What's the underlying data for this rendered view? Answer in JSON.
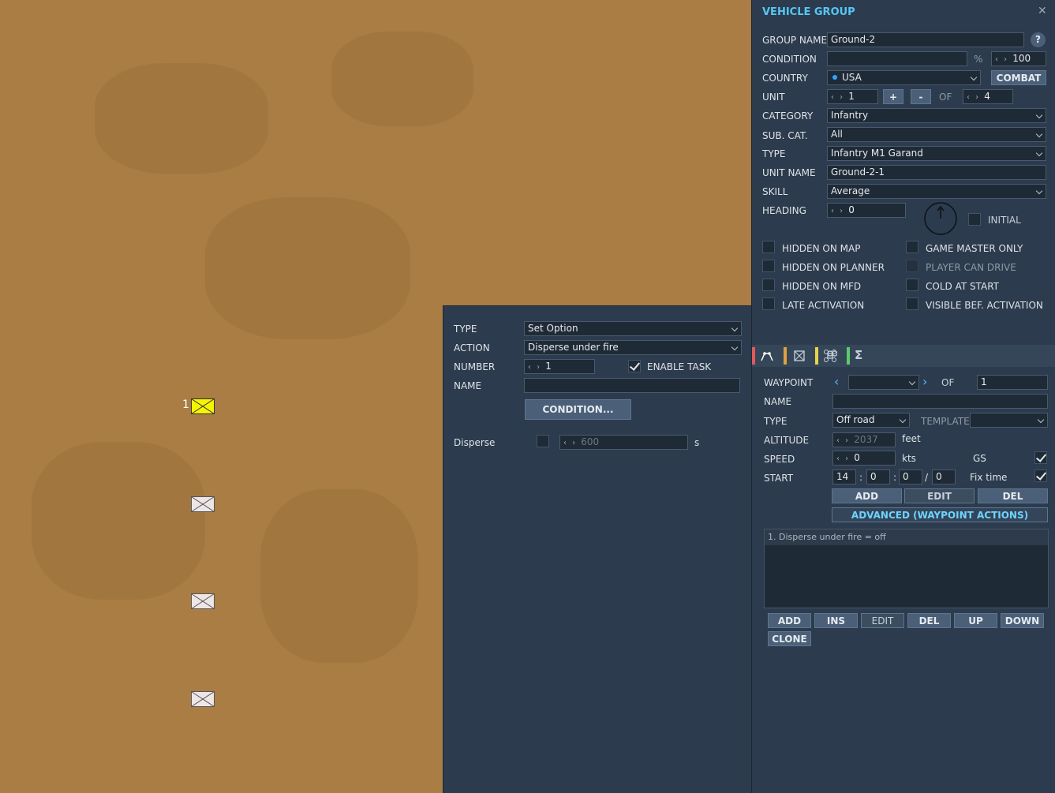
{
  "map": {
    "units": [
      {
        "label": "1",
        "active": true
      },
      {
        "label": "",
        "active": false
      },
      {
        "label": "",
        "active": false
      },
      {
        "label": "",
        "active": false
      }
    ],
    "colors": {
      "terrain": "#a97d44",
      "active_unit": "#f5f500",
      "inactive_unit": "#eee6e6"
    }
  },
  "task_panel": {
    "type_label": "TYPE",
    "type_value": "Set Option",
    "action_label": "ACTION",
    "action_value": "Disperse under fire",
    "number_label": "NUMBER",
    "number_value": "1",
    "enable_task_label": "ENABLE TASK",
    "enable_task_checked": true,
    "name_label": "NAME",
    "name_value": "",
    "condition_button": "CONDITION...",
    "disperse_label": "Disperse",
    "disperse_value": "600",
    "disperse_unit": "s"
  },
  "vehicle_group": {
    "title": "VEHICLE GROUP",
    "help": "?",
    "group_name_label": "GROUP NAME",
    "group_name_value": "Ground-2",
    "condition_label": "CONDITION",
    "condition_value": "",
    "condition_pct_symbol": "%",
    "condition_pct_value": "100",
    "country_label": "COUNTRY",
    "country_value": "USA",
    "combat_button": "COMBAT",
    "unit_label": "UNIT",
    "unit_value": "1",
    "plus_button": "+",
    "minus_button": "-",
    "of_label": "OF",
    "unit_total": "4",
    "category_label": "CATEGORY",
    "category_value": "Infantry",
    "subcat_label": "SUB. CAT.",
    "subcat_value": "All",
    "type_label": "TYPE",
    "type_value": "Infantry M1 Garand",
    "unit_name_label": "UNIT NAME",
    "unit_name_value": "Ground-2-1",
    "skill_label": "SKILL",
    "skill_value": "Average",
    "heading_label": "HEADING",
    "heading_value": "0",
    "initial_label": "INITIAL",
    "checkboxes": {
      "hidden_on_map": "HIDDEN ON MAP",
      "game_master_only": "GAME MASTER ONLY",
      "hidden_on_planner": "HIDDEN ON PLANNER",
      "player_can_drive": "PLAYER CAN DRIVE",
      "hidden_on_mfd": "HIDDEN ON MFD",
      "cold_at_start": "COLD AT START",
      "late_activation": "LATE ACTIVATION",
      "visible_bef_activation": "VISIBLE BEF. ACTIVATION"
    }
  },
  "waypoint": {
    "waypoint_label": "WAYPOINT",
    "waypoint_value": "",
    "of_label": "OF",
    "of_value": "1",
    "name_label": "NAME",
    "name_value": "",
    "type_label": "TYPE",
    "type_value": "Off road",
    "template_label": "TEMPLATE",
    "template_value": "",
    "altitude_label": "ALTITUDE",
    "altitude_value": "2037",
    "altitude_unit": "feet",
    "speed_label": "SPEED",
    "speed_value": "0",
    "speed_unit": "kts",
    "gs_label": "GS",
    "start_label": "START",
    "start_h": "14",
    "start_m": "0",
    "start_s": "0",
    "start_ms": "0",
    "sep_colon": ":",
    "sep_slash": "/",
    "fix_time_label": "Fix time",
    "add_button": "ADD",
    "edit_button": "EDIT",
    "del_button": "DEL",
    "advanced_button": "ADVANCED (WAYPOINT ACTIONS)",
    "actions": [
      "1. Disperse under fire = off"
    ],
    "list_buttons": {
      "add": "ADD",
      "ins": "INS",
      "edit": "EDIT",
      "del": "DEL",
      "up": "UP",
      "down": "DOWN",
      "clone": "CLONE"
    },
    "tab_colors": [
      "#e05a5a",
      "#e0a040",
      "#e6d44a",
      "#5ccc6a"
    ]
  }
}
